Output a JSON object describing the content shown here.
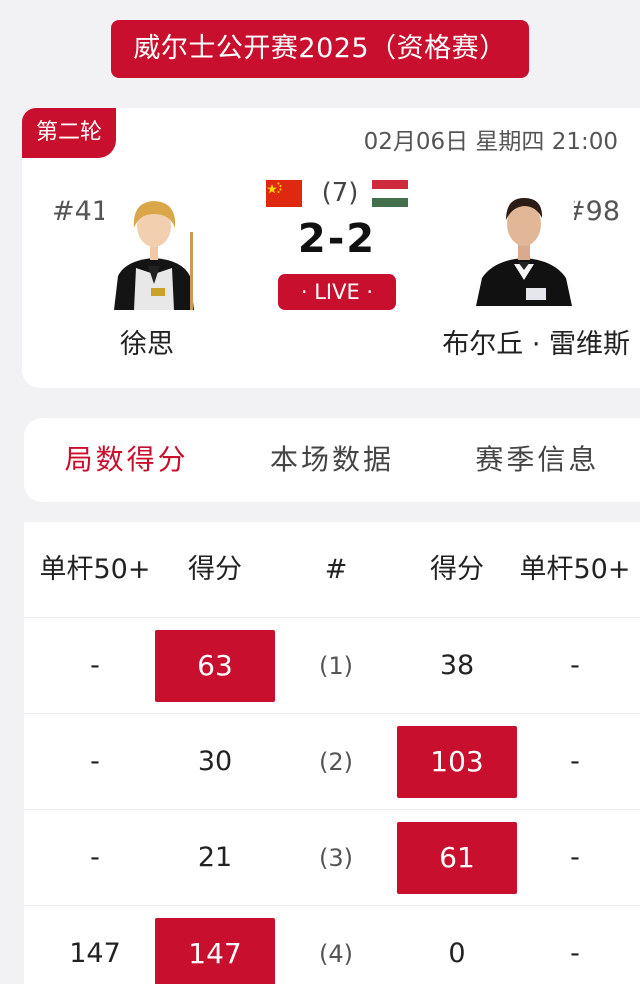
{
  "event_title": "威尔士公开赛2025（资格赛）",
  "match": {
    "round": "第二轮",
    "datetime": "02月06日 星期四 21:00",
    "best_of": "(7)",
    "score": "2-2",
    "status": "· LIVE ·",
    "player_left": {
      "seed": "#41",
      "name": "徐思",
      "flag": "china-flag-icon"
    },
    "player_right": {
      "seed": "#98",
      "name": "布尔丘 · 雷维斯",
      "flag": "hungary-flag-icon"
    }
  },
  "tabs": [
    "局数得分",
    "本场数据",
    "赛季信息"
  ],
  "active_tab": 0,
  "table": {
    "headers": [
      "单杆50+",
      "得分",
      "#",
      "得分",
      "单杆50+"
    ],
    "rows": [
      {
        "left_break": "-",
        "left_score": "63",
        "frame": "(1)",
        "right_score": "38",
        "right_break": "-",
        "winner": "left"
      },
      {
        "left_break": "-",
        "left_score": "30",
        "frame": "(2)",
        "right_score": "103",
        "right_break": "-",
        "winner": "right"
      },
      {
        "left_break": "-",
        "left_score": "21",
        "frame": "(3)",
        "right_score": "61",
        "right_break": "-",
        "winner": "right"
      },
      {
        "left_break": "147",
        "left_score": "147",
        "frame": "(4)",
        "right_score": "0",
        "right_break": "-",
        "winner": "left"
      }
    ]
  },
  "colors": {
    "accent": "#c8102e",
    "background": "#f2f2f4"
  }
}
